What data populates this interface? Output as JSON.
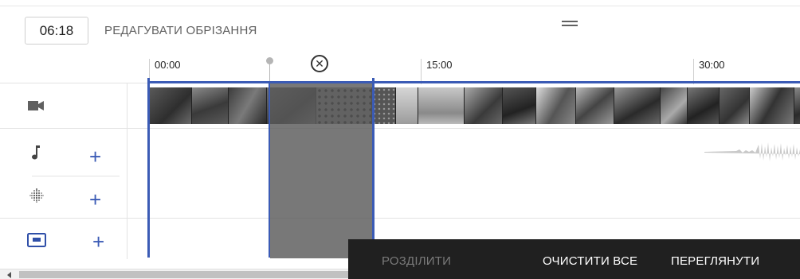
{
  "header": {
    "current_time": "06:18",
    "edit_trim_label": "РЕДАГУВАТИ ОБРІЗАННЯ"
  },
  "ruler": {
    "ticks": [
      "00:00",
      "15:00",
      "30:00"
    ]
  },
  "tracks": [
    {
      "name": "video",
      "icon": "video-camera-icon"
    },
    {
      "name": "audio",
      "icon": "music-note-icon",
      "add_label": "+"
    },
    {
      "name": "blur",
      "icon": "blur-dots-icon",
      "add_label": "+"
    },
    {
      "name": "end-screen",
      "icon": "end-screen-icon",
      "add_label": "+"
    }
  ],
  "cut": {
    "close_icon": "close-circle-icon"
  },
  "toolbar": {
    "split_label": "РОЗДІЛИТИ",
    "clear_all_label": "ОЧИСТИТИ ВСЕ",
    "preview_label": "ПЕРЕГЛЯНУТИ"
  },
  "colors": {
    "accent": "#3b5bb5",
    "toolbar_bg": "#202020",
    "cut_region": "#5a5a5a",
    "disabled_text": "#7a7a7a"
  }
}
